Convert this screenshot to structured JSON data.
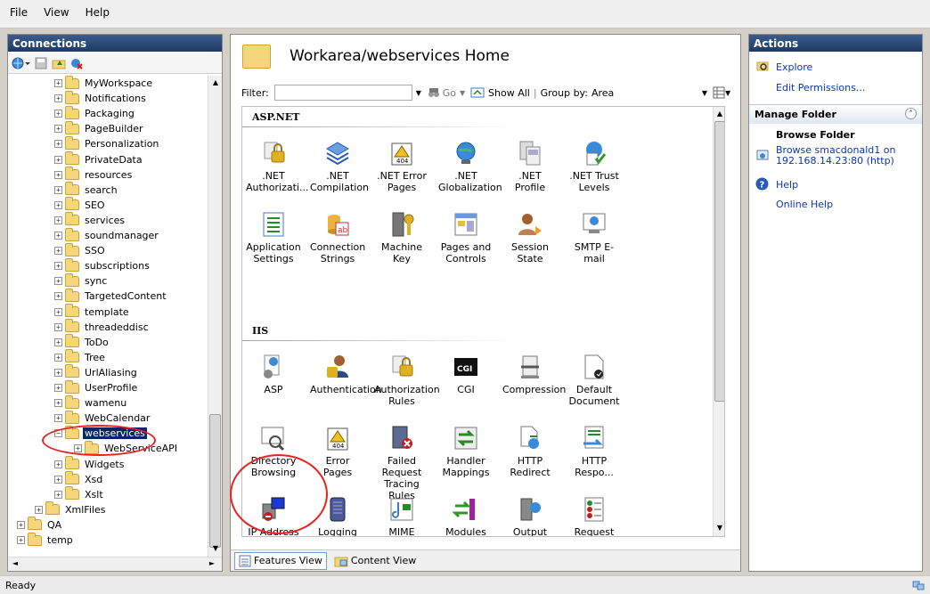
{
  "menu": {
    "file": "File",
    "view": "View",
    "help": "Help"
  },
  "connections": {
    "title": "Connections",
    "tree": [
      {
        "label": "MyWorkspace",
        "indent": 2
      },
      {
        "label": "Notifications",
        "indent": 2
      },
      {
        "label": "Packaging",
        "indent": 2
      },
      {
        "label": "PageBuilder",
        "indent": 2
      },
      {
        "label": "Personalization",
        "indent": 2
      },
      {
        "label": "PrivateData",
        "indent": 2
      },
      {
        "label": "resources",
        "indent": 2
      },
      {
        "label": "search",
        "indent": 2
      },
      {
        "label": "SEO",
        "indent": 2
      },
      {
        "label": "services",
        "indent": 2
      },
      {
        "label": "soundmanager",
        "indent": 2
      },
      {
        "label": "SSO",
        "indent": 2
      },
      {
        "label": "subscriptions",
        "indent": 2
      },
      {
        "label": "sync",
        "indent": 2
      },
      {
        "label": "TargetedContent",
        "indent": 2
      },
      {
        "label": "template",
        "indent": 2
      },
      {
        "label": "threadeddisc",
        "indent": 2
      },
      {
        "label": "ToDo",
        "indent": 2
      },
      {
        "label": "Tree",
        "indent": 2
      },
      {
        "label": "UrlAliasing",
        "indent": 2
      },
      {
        "label": "UserProfile",
        "indent": 2
      },
      {
        "label": "wamenu",
        "indent": 2
      },
      {
        "label": "WebCalendar",
        "indent": 2
      },
      {
        "label": "webservices",
        "indent": 2,
        "selected": true
      },
      {
        "label": "WebServiceAPI",
        "indent": 3
      },
      {
        "label": "Widgets",
        "indent": 2
      },
      {
        "label": "Xsd",
        "indent": 2
      },
      {
        "label": "Xslt",
        "indent": 2
      },
      {
        "label": "XmlFiles",
        "indent": 1
      },
      {
        "label": "QA",
        "indent": 0
      },
      {
        "label": "temp",
        "indent": 0
      }
    ]
  },
  "center": {
    "title": "Workarea/webservices Home",
    "filter_label": "Filter:",
    "go_label": "Go",
    "show_all_label": "Show All",
    "group_by_label": "Group by:",
    "group_by_value": "Area",
    "groups": [
      {
        "name": "ASP.NET",
        "items": [
          ".NET Authorizati...",
          ".NET Compilation",
          ".NET Error Pages",
          ".NET Globalization",
          ".NET Profile",
          ".NET Trust Levels",
          "Application Settings",
          "Connection Strings",
          "Machine Key",
          "Pages and Controls",
          "Session State",
          "SMTP E-mail"
        ]
      },
      {
        "name": "IIS",
        "items": [
          "ASP",
          "Authentication",
          "Authorization Rules",
          "CGI",
          "Compression",
          "Default Document",
          "Directory Browsing",
          "Error Pages",
          "Failed Request Tracing Rules",
          "Handler Mappings",
          "HTTP Redirect",
          "HTTP Respo...",
          "IP Address and Dom...",
          "Logging",
          "MIME Types",
          "Modules",
          "Output Caching",
          "Request Filtering"
        ]
      }
    ],
    "features_view_label": "Features View",
    "content_view_label": "Content View"
  },
  "actions": {
    "title": "Actions",
    "explore": "Explore",
    "edit_permissions": "Edit Permissions...",
    "manage_folder": "Manage Folder",
    "browse_folder": "Browse Folder",
    "browse_link": "Browse smacdonald1 on 192.168.14.23:80 (http)",
    "help": "Help",
    "online_help": "Online Help"
  },
  "status": {
    "text": "Ready"
  },
  "colors": {
    "header": "#1f3a63",
    "link": "#0a36b4",
    "annotation": "#e8231f",
    "selection": "#0a246a"
  }
}
